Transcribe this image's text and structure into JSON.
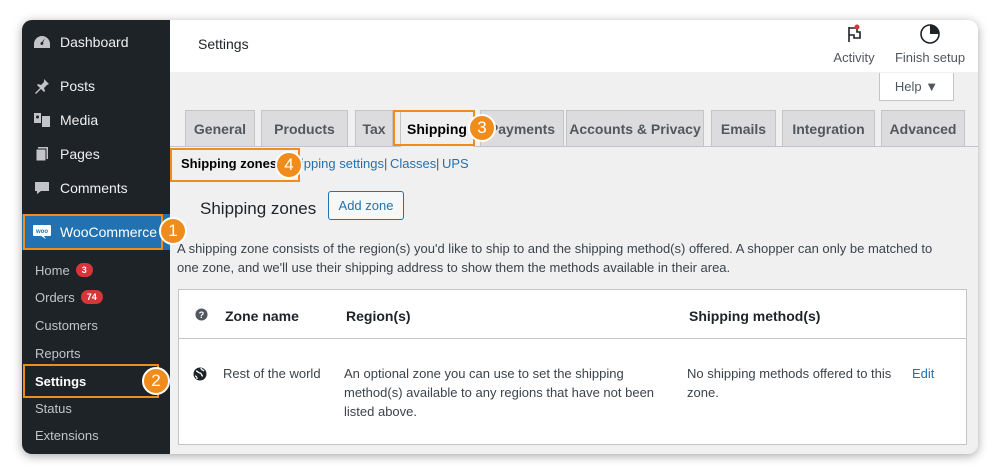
{
  "sidebar": {
    "top_items": [
      {
        "label": "Dashboard",
        "icon": "dashboard-icon"
      },
      {
        "label": "Posts",
        "icon": "pin-icon"
      },
      {
        "label": "Media",
        "icon": "media-icon"
      },
      {
        "label": "Pages",
        "icon": "pages-icon"
      },
      {
        "label": "Comments",
        "icon": "comments-icon"
      }
    ],
    "woocommerce": {
      "label": "WooCommerce",
      "icon": "woo-icon"
    },
    "sub_items": [
      {
        "label": "Home",
        "badge": "3"
      },
      {
        "label": "Orders",
        "badge": "74"
      },
      {
        "label": "Customers"
      },
      {
        "label": "Reports"
      },
      {
        "label": "Settings"
      },
      {
        "label": "Status"
      },
      {
        "label": "Extensions"
      }
    ]
  },
  "header": {
    "title": "Settings",
    "activity_label": "Activity",
    "finish_setup_label": "Finish setup",
    "help_label": "Help ▼"
  },
  "tabs": [
    "General",
    "Products",
    "Tax",
    "Shipping",
    "Payments",
    "Accounts & Privacy",
    "Emails",
    "Integration",
    "Advanced"
  ],
  "active_tab": "Shipping",
  "subnav": {
    "items": [
      "Shipping zones",
      "Shipping settings",
      "Classes",
      "UPS"
    ],
    "active": "Shipping zones"
  },
  "section": {
    "heading": "Shipping zones",
    "add_zone_label": "Add zone",
    "description": "A shipping zone consists of the region(s) you'd like to ship to and the shipping method(s) offered. A shopper can only be matched to one zone, and we'll use their shipping address to show them the methods available in their area."
  },
  "table": {
    "headers": {
      "zone_name": "Zone name",
      "regions": "Region(s)",
      "methods": "Shipping method(s)"
    },
    "row": {
      "zone_name": "Rest of the world",
      "regions": "An optional zone you can use to set the shipping method(s) available to any regions that have not been listed above.",
      "methods": "No shipping methods offered to this zone.",
      "edit_label": "Edit"
    }
  },
  "callouts": [
    "1",
    "2",
    "3",
    "4"
  ],
  "colors": {
    "sidebar": "#1d2327",
    "accent": "#2271b1",
    "callout": "#f08c1b",
    "badge": "#d63638"
  }
}
